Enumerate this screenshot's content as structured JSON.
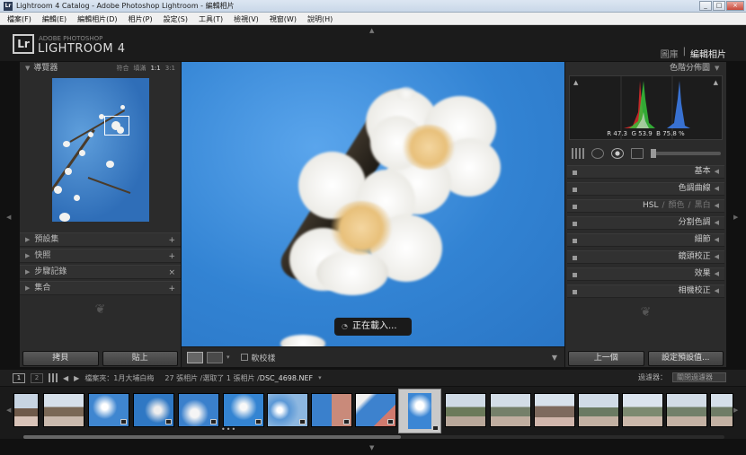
{
  "window": {
    "title": "Lightroom 4 Catalog - Adobe Photoshop Lightroom - 編輯相片",
    "app_icon": "Lr",
    "buttons": {
      "minimize": "_",
      "maximize": "□",
      "close": "×"
    }
  },
  "menu": [
    "檔案(F)",
    "編輯(E)",
    "編輯相片(D)",
    "相片(P)",
    "設定(S)",
    "工具(T)",
    "檢視(V)",
    "視窗(W)",
    "說明(H)"
  ],
  "brand": {
    "logo": "Lr",
    "small": "ADOBE PHOTOSHOP",
    "big": "LIGHTROOM 4"
  },
  "modules": {
    "library": "圖庫",
    "separator": "|",
    "develop": "編輯相片"
  },
  "left_panel": {
    "navigator": {
      "title": "導覽器",
      "zoom": [
        "符合",
        "填滿",
        "1:1",
        "3:1"
      ]
    },
    "sections": [
      {
        "label": "預設集",
        "action": "+"
      },
      {
        "label": "快照",
        "action": "+"
      },
      {
        "label": "步驟記錄",
        "action": "×"
      },
      {
        "label": "集合",
        "action": "+"
      }
    ],
    "buttons": {
      "copy": "拷貝",
      "paste": "貼上"
    }
  },
  "main_view": {
    "loading_text": "正在載入..."
  },
  "toolbar": {
    "softproof_label": "軟校樣"
  },
  "right_panel": {
    "histogram": {
      "title": "色階分佈圖",
      "info": {
        "r_label": "R",
        "r": "47.3",
        "g_label": "G",
        "g": "53.9",
        "b_label": "B",
        "b": "75.8",
        "unit": "%"
      }
    },
    "sections": [
      {
        "label": "基本"
      },
      {
        "label": "色調曲線"
      },
      {
        "label": "HSL",
        "sub1": "顏色",
        "sub2": "黑白",
        "sep": "/"
      },
      {
        "label": "分割色調"
      },
      {
        "label": "細節"
      },
      {
        "label": "鏡頭校正"
      },
      {
        "label": "效果"
      },
      {
        "label": "相機校正"
      }
    ],
    "buttons": {
      "previous": "上一個",
      "reset": "設定預設值..."
    }
  },
  "filmstrip": {
    "pages": [
      "1",
      "2"
    ],
    "source": "檔案夾：1月大埔白梅",
    "count": "27 張相片 /選取了 1 張相片 /",
    "filename": "DSC_4698.NEF",
    "filter_label": "過濾器：",
    "filter_value": "關閉過濾器"
  }
}
